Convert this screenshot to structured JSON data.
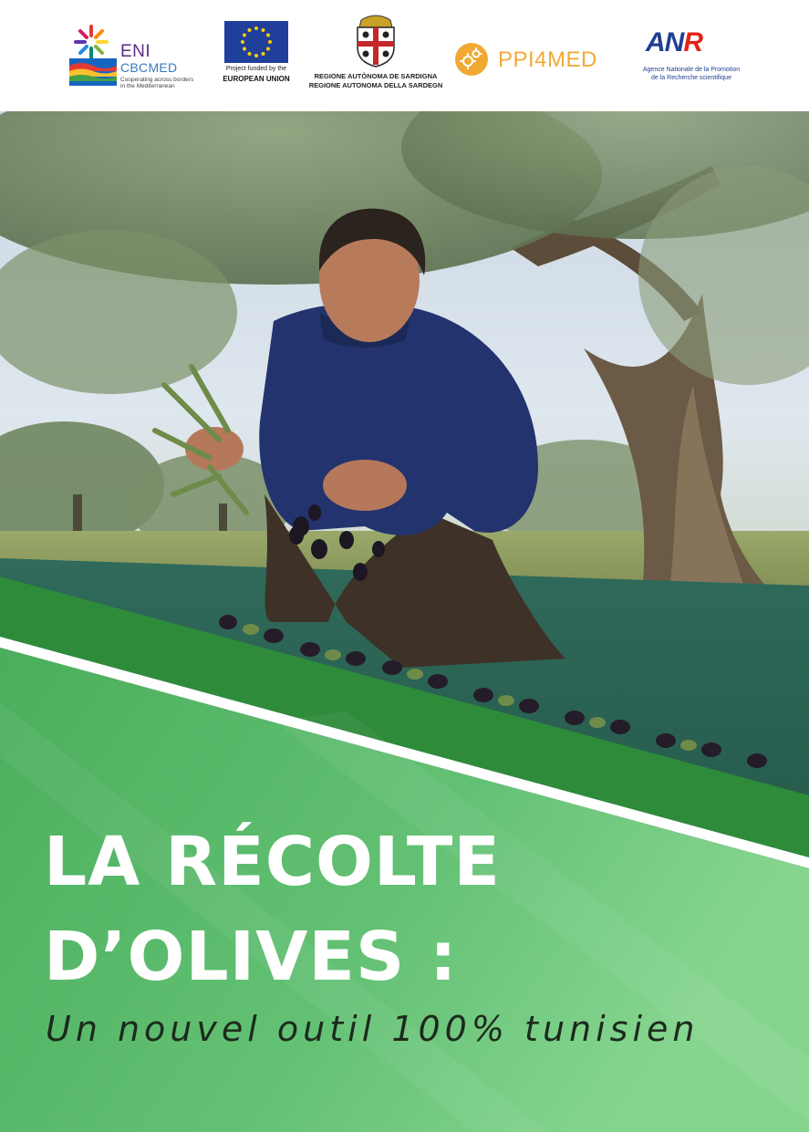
{
  "header": {
    "eni": {
      "line1": "ENI",
      "line2": "CBCMED",
      "tag1": "Cooperating across borders",
      "tag2": "in the Mediterranean"
    },
    "eu": {
      "line1": "Project  funded  by  the",
      "line2": "EUROPEAN UNION"
    },
    "sardegna": {
      "line1": "REGIONE AUTÒNOMA DE SARDIGNA",
      "line2": "REGIONE AUTONOMA DELLA SARDEGN"
    },
    "ppi": {
      "label": "PPI4MED"
    },
    "anr": {
      "mark_a": "AN",
      "mark_r": "R",
      "line1": "Agence Nationale de la Promotion",
      "line2": "de la Recherche scientifique"
    }
  },
  "cover": {
    "title_line1": "LA RÉCOLTE",
    "title_line2": "D’OLIVES :",
    "subtitle": "Un nouvel outil 100% tunisien"
  },
  "colors": {
    "green_dark": "#2e8b3a",
    "green_light": "#7fd08a",
    "eu_blue": "#1f3f9b",
    "eu_gold": "#ffcc00",
    "ppi_orange": "#f2a934",
    "anr_blue": "#1f3f93",
    "anr_red": "#e2231a"
  },
  "icons": {
    "eni": "eni-flower-icon",
    "eu": "eu-flag-icon",
    "sardegna": "sardinia-crest-icon",
    "ppi": "ppi-gears-icon"
  }
}
